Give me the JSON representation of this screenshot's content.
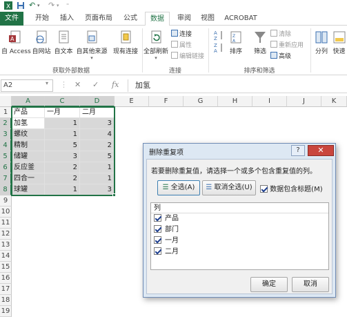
{
  "quick_access": {
    "undo_symbol": "↶",
    "redo_symbol": "↷"
  },
  "tabs": [
    "文件",
    "开始",
    "插入",
    "页面布局",
    "公式",
    "数据",
    "审阅",
    "视图",
    "ACROBAT"
  ],
  "active_tab": "数据",
  "ribbon": {
    "get_external": {
      "items": [
        "自 Access",
        "自网站",
        "自文本",
        "自其他来源",
        "现有连接"
      ],
      "label": "获取外部数据"
    },
    "connections": {
      "refresh_all": "全部刷新",
      "connections": "连接",
      "properties": "属性",
      "edit_links": "编辑链接",
      "label": "连接"
    },
    "sort_filter": {
      "sort": "排序",
      "filter": "筛选",
      "clear": "清除",
      "reapply": "重新应用",
      "advanced": "高级",
      "label": "排序和筛选"
    },
    "data_tools": {
      "split": "分列",
      "quick_fill": "快速"
    }
  },
  "formula_bar": {
    "name_box": "A2",
    "fx": "fx",
    "content": "加氢"
  },
  "grid": {
    "columns": [
      "A",
      "C",
      "D",
      "E",
      "F",
      "G",
      "H",
      "I",
      "J",
      "K"
    ],
    "rows": [
      "1",
      "2",
      "3",
      "4",
      "5",
      "6",
      "7",
      "8",
      "9",
      "10",
      "11",
      "12",
      "13",
      "14",
      "15",
      "16",
      "17",
      "18",
      "19"
    ],
    "header_row": [
      "产品",
      "一月",
      "二月"
    ],
    "data": [
      [
        "加氢",
        "1",
        "3"
      ],
      [
        "螺纹",
        "1",
        "4"
      ],
      [
        "精制",
        "5",
        "2"
      ],
      [
        "储罐",
        "3",
        "5"
      ],
      [
        "反应釜",
        "2",
        "1"
      ],
      [
        "四合一",
        "2",
        "1"
      ],
      [
        "球罐",
        "1",
        "3"
      ]
    ]
  },
  "dialog": {
    "title": "删除重复项",
    "help": "?",
    "close": "✕",
    "message": "若要删除重复值，请选择一个或多个包含重复值的列。",
    "select_all": "全选(A)",
    "unselect_all": "取消全选(U)",
    "has_headers": "数据包含标题(M)",
    "list_header": "列",
    "columns": [
      "产品",
      "部门",
      "一月",
      "二月"
    ],
    "ok": "确定",
    "cancel": "取消"
  },
  "colors": {
    "accent": "#217346",
    "dialog_frame": "#6f8bb4",
    "close": "#c9463d"
  }
}
